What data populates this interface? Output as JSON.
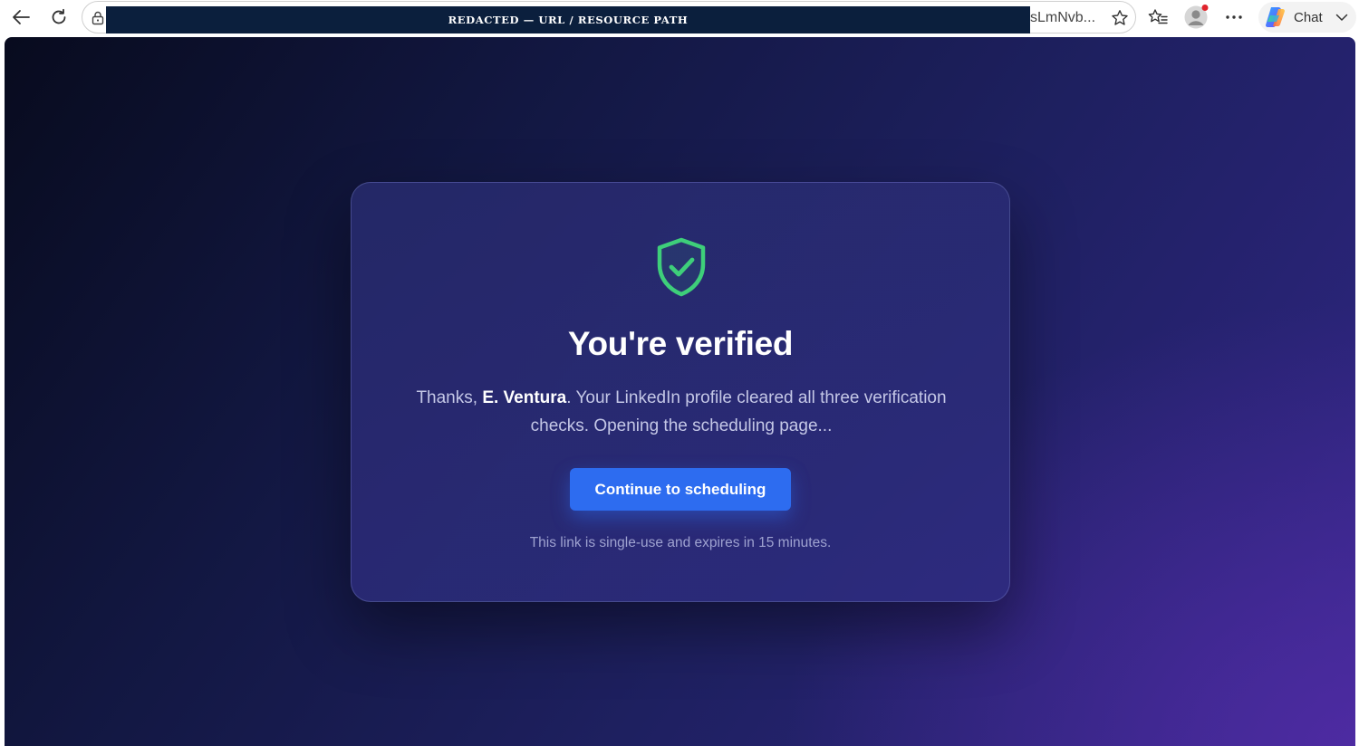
{
  "browser": {
    "url_redacted_label": "REDACTED — URL / RESOURCE PATH",
    "url_visible_tail": "sLmNvb...",
    "chat_label": "Chat"
  },
  "icons": {
    "back": "arrow-left-icon",
    "reload": "reload-icon",
    "lock": "lock-icon",
    "favorite": "star-icon",
    "favorites": "favorites-list-icon",
    "profile": "profile-avatar-icon",
    "more": "more-dots-icon",
    "chat": "copilot-logo-icon",
    "chevron": "chevron-down-icon",
    "verified": "shield-check-icon"
  },
  "colors": {
    "accent": "#2d6cf0",
    "success": "#3ecf7a"
  },
  "verification": {
    "title": "You're verified",
    "message_prefix": "Thanks, ",
    "user_name": "E. Ventura",
    "message_suffix": ". Your LinkedIn profile cleared all three verification checks. Opening the scheduling page...",
    "cta_label": "Continue to scheduling",
    "footnote": "This link is single-use and expires in 15 minutes."
  }
}
